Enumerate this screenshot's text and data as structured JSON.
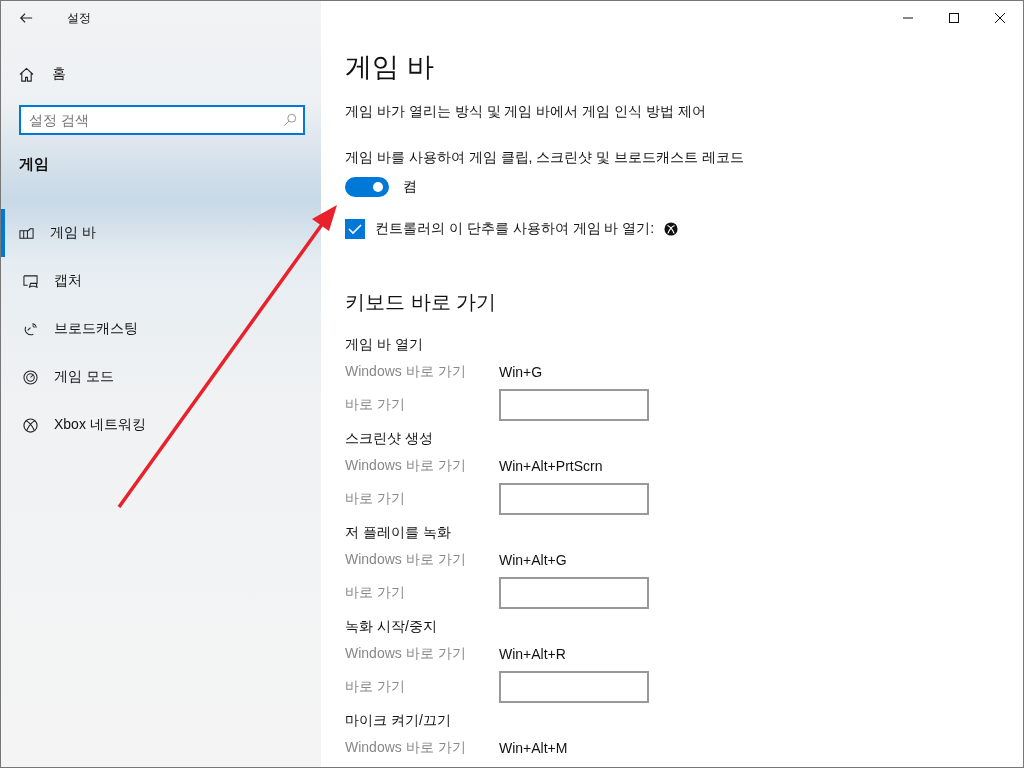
{
  "window": {
    "title": "설정"
  },
  "sidebar": {
    "home": "홈",
    "search": {
      "placeholder": "설정 검색"
    },
    "section": "게임",
    "items": [
      {
        "label": "게임 바",
        "kind": "gamebar",
        "selected": true
      },
      {
        "label": "캡처",
        "kind": "capture",
        "selected": false
      },
      {
        "label": "브로드캐스팅",
        "kind": "broadcast",
        "selected": false
      },
      {
        "label": "게임 모드",
        "kind": "gamemode",
        "selected": false
      },
      {
        "label": "Xbox 네트워킹",
        "kind": "xbox",
        "selected": false
      }
    ]
  },
  "page": {
    "title": "게임 바",
    "description": "게임 바가 열리는 방식 및 게임 바에서 게임 인식 방법 제어",
    "toggle": {
      "label": "게임 바를 사용하여 게임 클립, 스크린샷 및 브로드캐스트 레코드",
      "on": true,
      "state_text": "켬"
    },
    "checkbox": {
      "label": "컨트롤러의 이 단추를 사용하여 게임 바 열기:",
      "checked": true
    },
    "shortcuts_title": "키보드 바로 가기",
    "shortcuts": [
      {
        "title": "게임 바 열기",
        "default_label": "Windows 바로 가기",
        "default_value": "Win+G",
        "custom_label": "바로 가기"
      },
      {
        "title": "스크린샷 생성",
        "default_label": "Windows 바로 가기",
        "default_value": "Win+Alt+PrtScrn",
        "custom_label": "바로 가기"
      },
      {
        "title": "저 플레이를 녹화",
        "default_label": "Windows 바로 가기",
        "default_value": "Win+Alt+G",
        "custom_label": "바로 가기"
      },
      {
        "title": "녹화 시작/중지",
        "default_label": "Windows 바로 가기",
        "default_value": "Win+Alt+R",
        "custom_label": "바로 가기"
      },
      {
        "title": "마이크 켜기/끄기",
        "default_label": "Windows 바로 가기",
        "default_value": "Win+Alt+M"
      }
    ]
  }
}
